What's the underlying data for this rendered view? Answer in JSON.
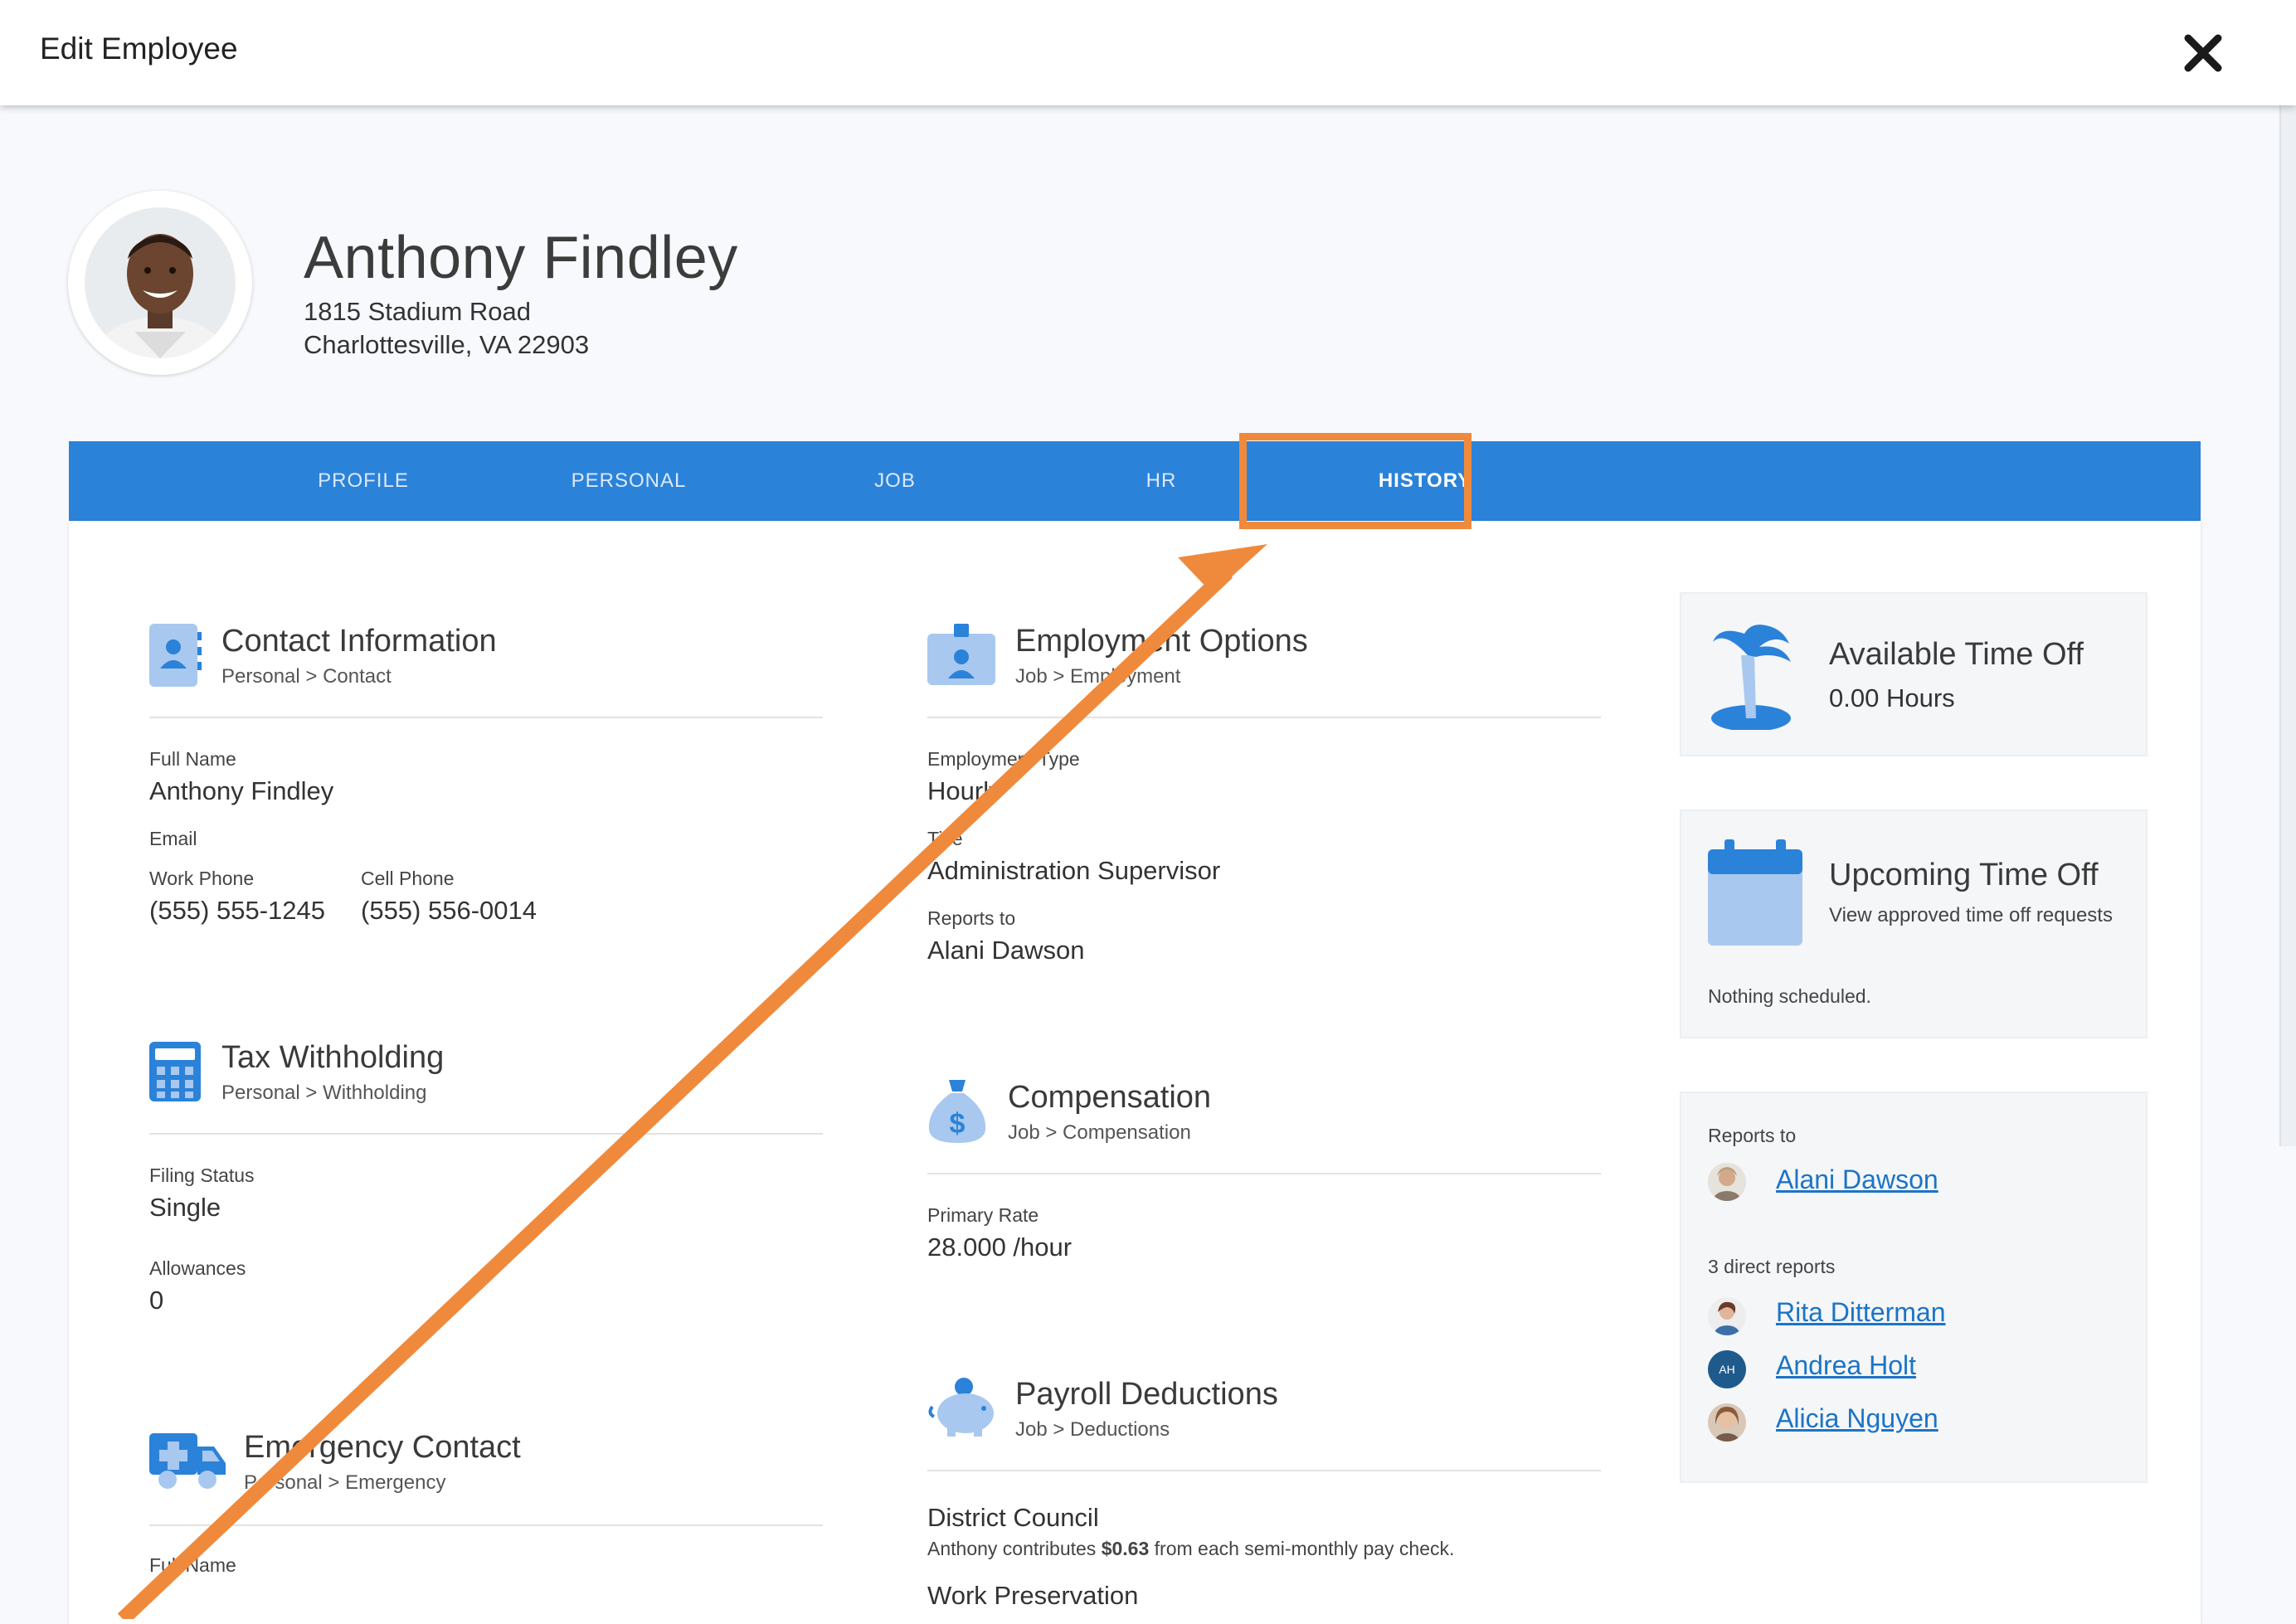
{
  "header": {
    "title": "Edit Employee",
    "close_icon": "close-icon"
  },
  "employee": {
    "name": "Anthony Findley",
    "address_line1": "1815 Stadium Road",
    "address_line2": "Charlottesville, VA 22903"
  },
  "tabs": [
    {
      "label": "PROFILE"
    },
    {
      "label": "PERSONAL"
    },
    {
      "label": "JOB"
    },
    {
      "label": "HR"
    },
    {
      "label": "HISTORY",
      "active": true
    }
  ],
  "contact": {
    "title": "Contact Information",
    "breadcrumb": "Personal > Contact",
    "full_name_label": "Full Name",
    "full_name": "Anthony Findley",
    "email_label": "Email",
    "work_phone_label": "Work Phone",
    "work_phone": "(555) 555-1245",
    "cell_phone_label": "Cell Phone",
    "cell_phone": "(555) 556-0014"
  },
  "tax": {
    "title": "Tax Withholding",
    "breadcrumb": "Personal > Withholding",
    "filing_status_label": "Filing Status",
    "filing_status": "Single",
    "allowances_label": "Allowances",
    "allowances": "0"
  },
  "emergency": {
    "title": "Emergency Contact",
    "breadcrumb": "Personal > Emergency",
    "full_name_label": "Full Name"
  },
  "employment": {
    "title": "Employment Options",
    "breadcrumb": "Job > Employment",
    "type_label": "Employment Type",
    "type": "Hourly",
    "title_label": "Title",
    "job_title": "Administration Supervisor",
    "reports_to_label": "Reports to",
    "reports_to": "Alani Dawson"
  },
  "compensation": {
    "title": "Compensation",
    "breadcrumb": "Job > Compensation",
    "rate_label": "Primary Rate",
    "rate": "28.000 /hour"
  },
  "deductions": {
    "title": "Payroll Deductions",
    "breadcrumb": "Job > Deductions",
    "item1_name": "District Council",
    "item1_pre": "Anthony contributes ",
    "item1_amount": "$0.63",
    "item1_post": " from each semi-monthly pay check.",
    "item2_name": "Work Preservation"
  },
  "time_off": {
    "title": "Available Time Off",
    "hours": "0.00 Hours"
  },
  "upcoming": {
    "title": "Upcoming Time Off",
    "subtitle": "View approved time off requests",
    "empty": "Nothing scheduled."
  },
  "org": {
    "reports_to_label": "Reports to",
    "manager": "Alani Dawson",
    "direct_reports_label": "3 direct reports",
    "reports": [
      {
        "name": "Rita Ditterman"
      },
      {
        "name": "Andrea Holt",
        "initials": "AH"
      },
      {
        "name": "Alicia Nguyen"
      }
    ]
  },
  "colors": {
    "tab_bar": "#2b82d9",
    "highlight": "#ef8a3d",
    "link": "#1b74c6",
    "icon": "#2b82d9"
  }
}
